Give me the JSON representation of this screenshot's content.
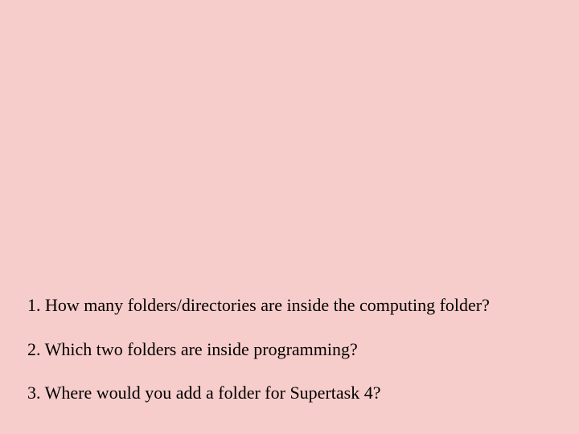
{
  "questions": [
    {
      "number": "1.",
      "text": "How many folders/directories are inside the computing folder?"
    },
    {
      "number": "2.",
      "text": "Which two folders are inside programming?"
    },
    {
      "number": "3.",
      "text": "Where would you add a folder for Supertask 4?"
    }
  ]
}
